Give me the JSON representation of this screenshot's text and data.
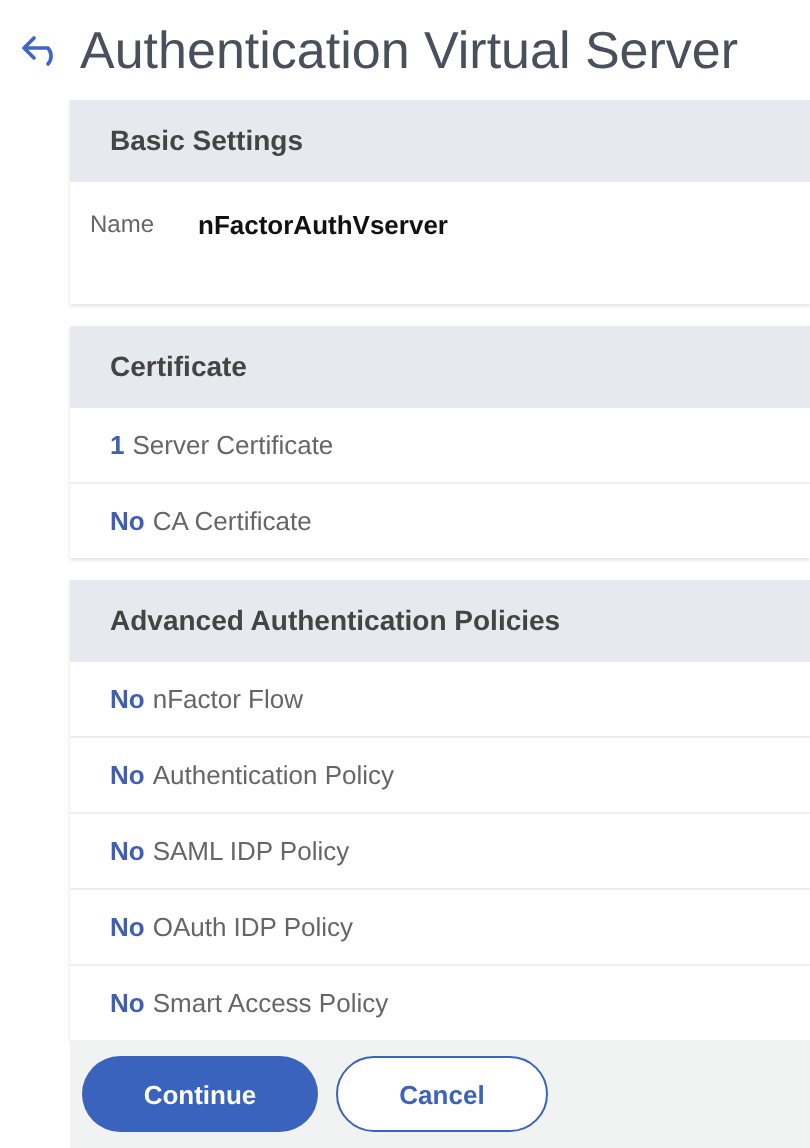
{
  "page": {
    "title": "Authentication Virtual Server"
  },
  "sections": [
    {
      "title": "Basic Settings",
      "kind": "fields",
      "fields": [
        {
          "label": "Name",
          "value": "nFactorAuthVserver"
        }
      ]
    },
    {
      "title": "Certificate",
      "kind": "counts",
      "items": [
        {
          "count": "1",
          "label": "Server Certificate"
        },
        {
          "count": "No",
          "label": "CA Certificate"
        }
      ]
    },
    {
      "title": "Advanced Authentication Policies",
      "kind": "counts",
      "items": [
        {
          "count": "No",
          "label": "nFactor Flow"
        },
        {
          "count": "No",
          "label": "Authentication Policy"
        },
        {
          "count": "No",
          "label": "SAML IDP Policy"
        },
        {
          "count": "No",
          "label": "OAuth IDP Policy"
        },
        {
          "count": "No",
          "label": "Smart Access Policy"
        }
      ]
    }
  ],
  "buttons": [
    {
      "label": "Continue",
      "kind": "primary"
    },
    {
      "label": "Cancel",
      "kind": "secondary"
    }
  ]
}
